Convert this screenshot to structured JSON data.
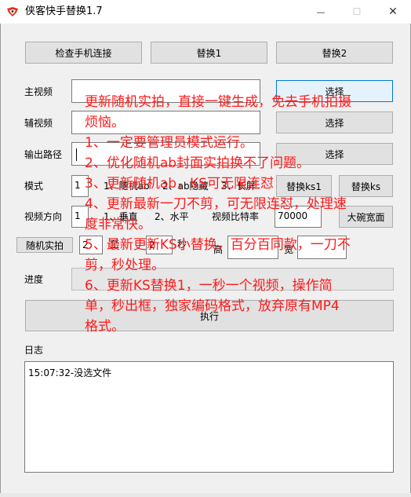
{
  "window": {
    "title": "侠客快手替换1.7",
    "minimize_glyph": "—",
    "maximize_glyph": "☐",
    "close_glyph": "✕"
  },
  "toolbar": {
    "check_phone": "检查手机连接",
    "replace1": "替换1",
    "replace2": "替换2"
  },
  "form": {
    "main_video_label": "主视频",
    "aux_video_label": "辅视频",
    "output_path_label": "输出路径",
    "select": "选择",
    "mode_label": "模式",
    "mode_value": "1",
    "mode_option1": "1、随机ab",
    "mode_option2": "2、ab隐藏",
    "mode_option3": "3、长屏",
    "replace_ks1": "替换ks1",
    "replace_ks": "替换ks",
    "direction_label": "视频方向",
    "direction_value": "1",
    "direction_option1": "1、垂直",
    "direction_option2": "2、水平",
    "bitrate_label": "视频比特率",
    "bitrate_value": "70000",
    "big_screen": "大碗宽面",
    "random_shot": "随机实拍",
    "random_from": "2",
    "random_to": "2",
    "random_to_separator": "至",
    "seconds_unit": "秒",
    "height_label": "高",
    "width_label": "宽",
    "progress_label": "进度",
    "execute": "执行",
    "log_label": "日志"
  },
  "log": {
    "lines": [
      "15:07:32-没选文件"
    ]
  },
  "overlay": {
    "lines": [
      "更新随机实拍，直接一键生成，免去手机拍摄",
      "烦恼。",
      "1、一定要管理员模式运行。",
      "2、优化随机ab封面实拍换不了问题。",
      "3、更新随机ab，KS可无限连怼",
      "4、更新最新一刀不剪，可无限连怼，处理速",
      "度非常快。",
      "5、最新更新KS小替换，百分百同款，一刀不",
      "剪，秒处理。",
      "6、更新KS替换1，一秒一个视频，操作简",
      "单，秒出框，独家编码格式，放弃原有MP4",
      "格式。"
    ],
    "color": "#ff1a1a"
  }
}
